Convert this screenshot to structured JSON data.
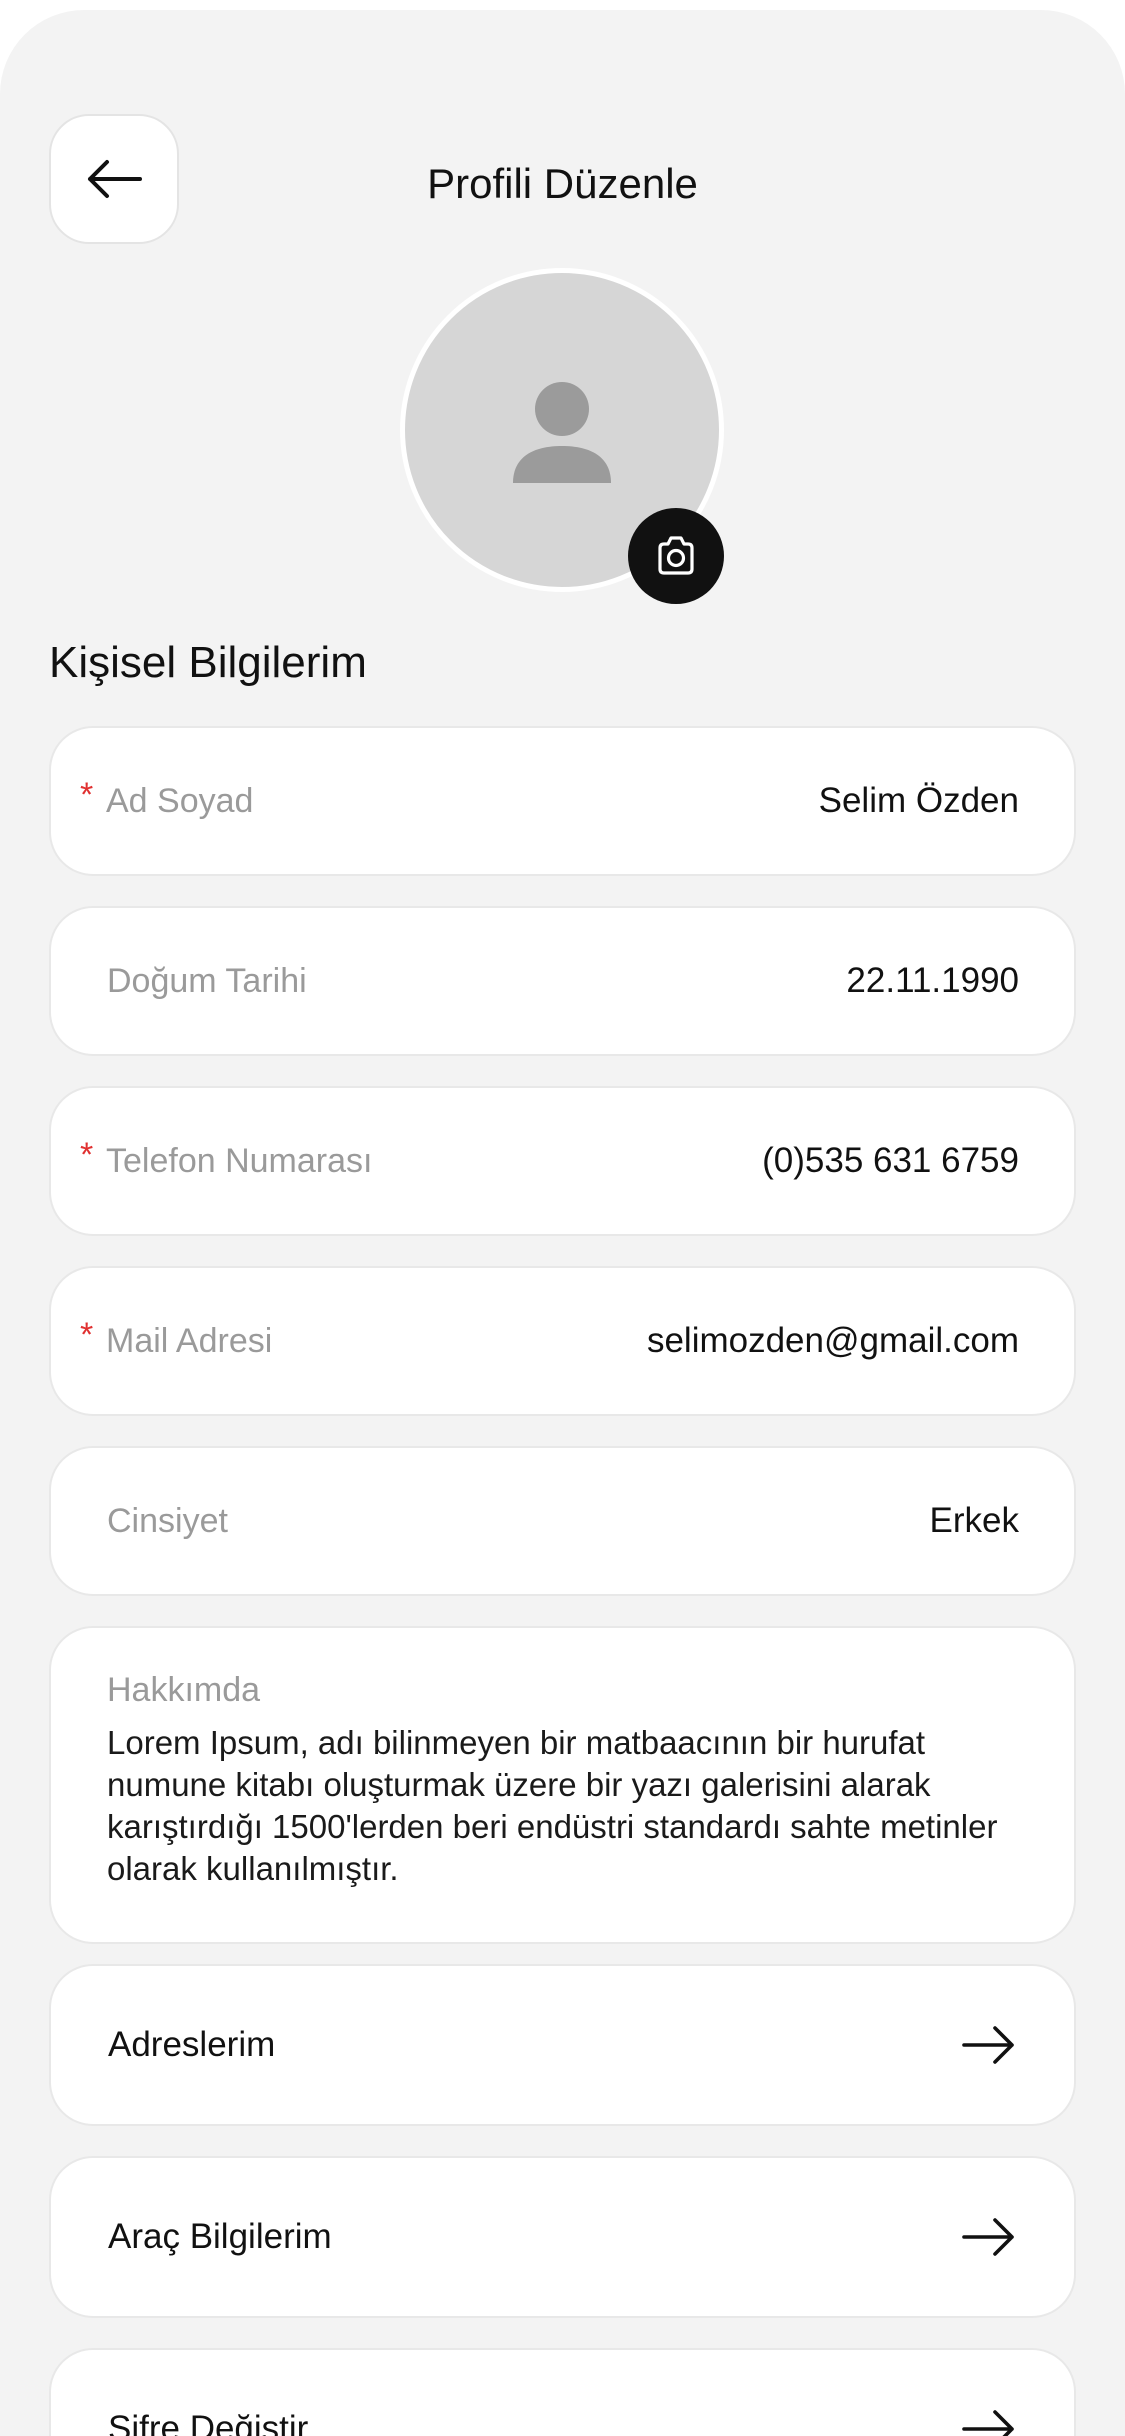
{
  "header": {
    "title": "Profili Düzenle",
    "back_icon": "arrow-left-icon"
  },
  "avatar": {
    "placeholder_icon": "person-icon",
    "camera_icon": "camera-icon",
    "colors": {
      "avatar_bg": "#d6d6d6",
      "placeholder": "#9b9b9b",
      "camera_bg": "#111111"
    }
  },
  "section": {
    "title": "Kişisel Bilgilerim"
  },
  "fields": [
    {
      "label": "Ad Soyad",
      "value": "Selim Özden",
      "required": true
    },
    {
      "label": "Doğum Tarihi",
      "value": "22.11.1990",
      "required": false
    },
    {
      "label": "Telefon Numarası",
      "value": "(0)535 631 6759",
      "required": true
    },
    {
      "label": "Mail Adresi",
      "value": "selimozden@gmail.com",
      "required": true
    },
    {
      "label": "Cinsiyet",
      "value": "Erkek",
      "required": false
    }
  ],
  "required_marker": "*",
  "about": {
    "label": "Hakkımda",
    "text": "Lorem Ipsum, adı bilinmeyen bir matbaacının bir hurufat numune kitabı oluşturmak üzere bir yazı galerisini alarak karıştırdığı 1500'lerden beri endüstri standardı sahte metinler olarak kullanılmıştır."
  },
  "links": [
    {
      "label": "Adreslerim",
      "icon": "arrow-right-icon"
    },
    {
      "label": "Araç Bilgilerim",
      "icon": "arrow-right-icon"
    },
    {
      "label": "Şifre Değiştir",
      "icon": "arrow-right-icon"
    }
  ],
  "colors": {
    "background": "#f3f3f3",
    "card": "#ffffff",
    "required": "#e03030",
    "label": "#9a9a9a",
    "text": "#111111"
  }
}
